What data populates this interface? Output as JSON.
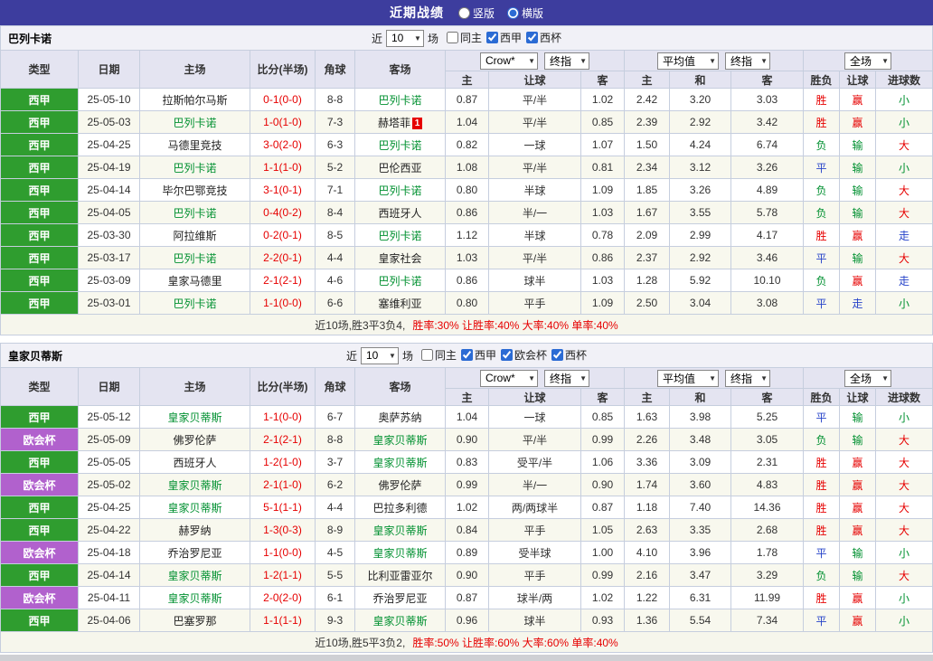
{
  "colors": {
    "topbar_bg": "#3d3d9e",
    "league_green": "#2f9d2f",
    "league_purple": "#b161cd",
    "win_red": "#e60000",
    "lose_green": "#009030",
    "draw_blue": "#2743c9",
    "header_bg": "#e4e4f1",
    "alt_row_bg": "#f8f8ee"
  },
  "topbar": {
    "title": "近期战绩",
    "radios": [
      {
        "label": "竖版",
        "selected": false
      },
      {
        "label": "横版",
        "selected": true
      }
    ]
  },
  "sections": [
    {
      "team": "巴列卡诺",
      "filter": {
        "near": "近",
        "count": "10",
        "unit": "场",
        "checks": [
          {
            "label": "同主",
            "checked": false
          },
          {
            "label": "西甲",
            "checked": true
          },
          {
            "label": "西杯",
            "checked": true
          }
        ]
      },
      "header": {
        "cols": [
          "类型",
          "日期",
          "主场",
          "比分(半场)",
          "角球",
          "客场"
        ],
        "odds1": [
          "Crow*",
          "终指"
        ],
        "odds2": [
          "平均值",
          "终指"
        ],
        "full": "全场",
        "sub": [
          "主",
          "让球",
          "客",
          "主",
          "和",
          "客",
          "胜负",
          "让球",
          "进球数"
        ]
      },
      "rows": [
        {
          "league": "西甲",
          "lc": "g",
          "date": "25-05-10",
          "home": "拉斯帕尔马斯",
          "hf": false,
          "score": "0-1(0-0)",
          "corner": "8-8",
          "away": "巴列卡诺",
          "af": true,
          "o": [
            "0.87",
            "平/半",
            "1.02"
          ],
          "a": [
            "2.42",
            "3.20",
            "3.03"
          ],
          "res": [
            [
              "胜",
              "r"
            ],
            [
              "赢",
              "r"
            ],
            [
              "小",
              "g"
            ]
          ]
        },
        {
          "league": "西甲",
          "lc": "g",
          "date": "25-05-03",
          "home": "巴列卡诺",
          "hf": true,
          "score": "1-0(1-0)",
          "corner": "7-3",
          "away": "赫塔菲",
          "af": false,
          "away_badge": "1",
          "o": [
            "1.04",
            "平/半",
            "0.85"
          ],
          "a": [
            "2.39",
            "2.92",
            "3.42"
          ],
          "res": [
            [
              "胜",
              "r"
            ],
            [
              "赢",
              "r"
            ],
            [
              "小",
              "g"
            ]
          ]
        },
        {
          "league": "西甲",
          "lc": "g",
          "date": "25-04-25",
          "home": "马德里竞技",
          "hf": false,
          "score": "3-0(2-0)",
          "corner": "6-3",
          "away": "巴列卡诺",
          "af": true,
          "o": [
            "0.82",
            "一球",
            "1.07"
          ],
          "a": [
            "1.50",
            "4.24",
            "6.74"
          ],
          "res": [
            [
              "负",
              "g"
            ],
            [
              "输",
              "g"
            ],
            [
              "大",
              "r"
            ]
          ]
        },
        {
          "league": "西甲",
          "lc": "g",
          "date": "25-04-19",
          "home": "巴列卡诺",
          "hf": true,
          "score": "1-1(1-0)",
          "corner": "5-2",
          "away": "巴伦西亚",
          "af": false,
          "o": [
            "1.08",
            "平/半",
            "0.81"
          ],
          "a": [
            "2.34",
            "3.12",
            "3.26"
          ],
          "res": [
            [
              "平",
              "b"
            ],
            [
              "输",
              "g"
            ],
            [
              "小",
              "g"
            ]
          ]
        },
        {
          "league": "西甲",
          "lc": "g",
          "date": "25-04-14",
          "home": "毕尔巴鄂竞技",
          "hf": false,
          "score": "3-1(0-1)",
          "corner": "7-1",
          "away": "巴列卡诺",
          "af": true,
          "o": [
            "0.80",
            "半球",
            "1.09"
          ],
          "a": [
            "1.85",
            "3.26",
            "4.89"
          ],
          "res": [
            [
              "负",
              "g"
            ],
            [
              "输",
              "g"
            ],
            [
              "大",
              "r"
            ]
          ]
        },
        {
          "league": "西甲",
          "lc": "g",
          "date": "25-04-05",
          "home": "巴列卡诺",
          "hf": true,
          "score": "0-4(0-2)",
          "corner": "8-4",
          "away": "西班牙人",
          "af": false,
          "o": [
            "0.86",
            "半/一",
            "1.03"
          ],
          "a": [
            "1.67",
            "3.55",
            "5.78"
          ],
          "res": [
            [
              "负",
              "g"
            ],
            [
              "输",
              "g"
            ],
            [
              "大",
              "r"
            ]
          ]
        },
        {
          "league": "西甲",
          "lc": "g",
          "date": "25-03-30",
          "home": "阿拉维斯",
          "hf": false,
          "score": "0-2(0-1)",
          "corner": "8-5",
          "away": "巴列卡诺",
          "af": true,
          "o": [
            "1.12",
            "半球",
            "0.78"
          ],
          "a": [
            "2.09",
            "2.99",
            "4.17"
          ],
          "res": [
            [
              "胜",
              "r"
            ],
            [
              "赢",
              "r"
            ],
            [
              "走",
              "b"
            ]
          ]
        },
        {
          "league": "西甲",
          "lc": "g",
          "date": "25-03-17",
          "home": "巴列卡诺",
          "hf": true,
          "score": "2-2(0-1)",
          "corner": "4-4",
          "away": "皇家社会",
          "af": false,
          "o": [
            "1.03",
            "平/半",
            "0.86"
          ],
          "a": [
            "2.37",
            "2.92",
            "3.46"
          ],
          "res": [
            [
              "平",
              "b"
            ],
            [
              "输",
              "g"
            ],
            [
              "大",
              "r"
            ]
          ]
        },
        {
          "league": "西甲",
          "lc": "g",
          "date": "25-03-09",
          "home": "皇家马德里",
          "hf": false,
          "score": "2-1(2-1)",
          "corner": "4-6",
          "away": "巴列卡诺",
          "af": true,
          "o": [
            "0.86",
            "球半",
            "1.03"
          ],
          "a": [
            "1.28",
            "5.92",
            "10.10"
          ],
          "res": [
            [
              "负",
              "g"
            ],
            [
              "赢",
              "r"
            ],
            [
              "走",
              "b"
            ]
          ]
        },
        {
          "league": "西甲",
          "lc": "g",
          "date": "25-03-01",
          "home": "巴列卡诺",
          "hf": true,
          "score": "1-1(0-0)",
          "corner": "6-6",
          "away": "塞维利亚",
          "af": false,
          "o": [
            "0.80",
            "平手",
            "1.09"
          ],
          "a": [
            "2.50",
            "3.04",
            "3.08"
          ],
          "res": [
            [
              "平",
              "b"
            ],
            [
              "走",
              "b"
            ],
            [
              "小",
              "g"
            ]
          ]
        }
      ],
      "footer": {
        "summary": "近10场,胜3平3负4,",
        "rates": "胜率:30% 让胜率:40% 大率:40% 单率:40%"
      }
    },
    {
      "team": "皇家贝蒂斯",
      "filter": {
        "near": "近",
        "count": "10",
        "unit": "场",
        "checks": [
          {
            "label": "同主",
            "checked": false
          },
          {
            "label": "西甲",
            "checked": true
          },
          {
            "label": "欧会杯",
            "checked": true
          },
          {
            "label": "西杯",
            "checked": true
          }
        ]
      },
      "header": {
        "cols": [
          "类型",
          "日期",
          "主场",
          "比分(半场)",
          "角球",
          "客场"
        ],
        "odds1": [
          "Crow*",
          "终指"
        ],
        "odds2": [
          "平均值",
          "终指"
        ],
        "full": "全场",
        "sub": [
          "主",
          "让球",
          "客",
          "主",
          "和",
          "客",
          "胜负",
          "让球",
          "进球数"
        ]
      },
      "rows": [
        {
          "league": "西甲",
          "lc": "g",
          "date": "25-05-12",
          "home": "皇家贝蒂斯",
          "hf": true,
          "score": "1-1(0-0)",
          "corner": "6-7",
          "away": "奥萨苏纳",
          "af": false,
          "o": [
            "1.04",
            "一球",
            "0.85"
          ],
          "a": [
            "1.63",
            "3.98",
            "5.25"
          ],
          "res": [
            [
              "平",
              "b"
            ],
            [
              "输",
              "g"
            ],
            [
              "小",
              "g"
            ]
          ]
        },
        {
          "league": "欧会杯",
          "lc": "p",
          "date": "25-05-09",
          "home": "佛罗伦萨",
          "hf": false,
          "score": "2-1(2-1)",
          "corner": "8-8",
          "away": "皇家贝蒂斯",
          "af": true,
          "o": [
            "0.90",
            "平/半",
            "0.99"
          ],
          "a": [
            "2.26",
            "3.48",
            "3.05"
          ],
          "res": [
            [
              "负",
              "g"
            ],
            [
              "输",
              "g"
            ],
            [
              "大",
              "r"
            ]
          ]
        },
        {
          "league": "西甲",
          "lc": "g",
          "date": "25-05-05",
          "home": "西班牙人",
          "hf": false,
          "score": "1-2(1-0)",
          "corner": "3-7",
          "away": "皇家贝蒂斯",
          "af": true,
          "o": [
            "0.83",
            "受平/半",
            "1.06"
          ],
          "a": [
            "3.36",
            "3.09",
            "2.31"
          ],
          "res": [
            [
              "胜",
              "r"
            ],
            [
              "赢",
              "r"
            ],
            [
              "大",
              "r"
            ]
          ]
        },
        {
          "league": "欧会杯",
          "lc": "p",
          "date": "25-05-02",
          "home": "皇家贝蒂斯",
          "hf": true,
          "score": "2-1(1-0)",
          "corner": "6-2",
          "away": "佛罗伦萨",
          "af": false,
          "o": [
            "0.99",
            "半/一",
            "0.90"
          ],
          "a": [
            "1.74",
            "3.60",
            "4.83"
          ],
          "res": [
            [
              "胜",
              "r"
            ],
            [
              "赢",
              "r"
            ],
            [
              "大",
              "r"
            ]
          ]
        },
        {
          "league": "西甲",
          "lc": "g",
          "date": "25-04-25",
          "home": "皇家贝蒂斯",
          "hf": true,
          "score": "5-1(1-1)",
          "corner": "4-4",
          "away": "巴拉多利德",
          "af": false,
          "o": [
            "1.02",
            "两/两球半",
            "0.87"
          ],
          "a": [
            "1.18",
            "7.40",
            "14.36"
          ],
          "res": [
            [
              "胜",
              "r"
            ],
            [
              "赢",
              "r"
            ],
            [
              "大",
              "r"
            ]
          ]
        },
        {
          "league": "西甲",
          "lc": "g",
          "date": "25-04-22",
          "home": "赫罗纳",
          "hf": false,
          "score": "1-3(0-3)",
          "corner": "8-9",
          "away": "皇家贝蒂斯",
          "af": true,
          "o": [
            "0.84",
            "平手",
            "1.05"
          ],
          "a": [
            "2.63",
            "3.35",
            "2.68"
          ],
          "res": [
            [
              "胜",
              "r"
            ],
            [
              "赢",
              "r"
            ],
            [
              "大",
              "r"
            ]
          ]
        },
        {
          "league": "欧会杯",
          "lc": "p",
          "date": "25-04-18",
          "home": "乔治罗尼亚",
          "hf": false,
          "score": "1-1(0-0)",
          "corner": "4-5",
          "away": "皇家贝蒂斯",
          "af": true,
          "o": [
            "0.89",
            "受半球",
            "1.00"
          ],
          "a": [
            "4.10",
            "3.96",
            "1.78"
          ],
          "res": [
            [
              "平",
              "b"
            ],
            [
              "输",
              "g"
            ],
            [
              "小",
              "g"
            ]
          ]
        },
        {
          "league": "西甲",
          "lc": "g",
          "date": "25-04-14",
          "home": "皇家贝蒂斯",
          "hf": true,
          "score": "1-2(1-1)",
          "corner": "5-5",
          "away": "比利亚雷亚尔",
          "af": false,
          "o": [
            "0.90",
            "平手",
            "0.99"
          ],
          "a": [
            "2.16",
            "3.47",
            "3.29"
          ],
          "res": [
            [
              "负",
              "g"
            ],
            [
              "输",
              "g"
            ],
            [
              "大",
              "r"
            ]
          ]
        },
        {
          "league": "欧会杯",
          "lc": "p",
          "date": "25-04-11",
          "home": "皇家贝蒂斯",
          "hf": true,
          "score": "2-0(2-0)",
          "corner": "6-1",
          "away": "乔治罗尼亚",
          "af": false,
          "o": [
            "0.87",
            "球半/两",
            "1.02"
          ],
          "a": [
            "1.22",
            "6.31",
            "11.99"
          ],
          "res": [
            [
              "胜",
              "r"
            ],
            [
              "赢",
              "r"
            ],
            [
              "小",
              "g"
            ]
          ]
        },
        {
          "league": "西甲",
          "lc": "g",
          "date": "25-04-06",
          "home": "巴塞罗那",
          "hf": false,
          "score": "1-1(1-1)",
          "corner": "9-3",
          "away": "皇家贝蒂斯",
          "af": true,
          "o": [
            "0.96",
            "球半",
            "0.93"
          ],
          "a": [
            "1.36",
            "5.54",
            "7.34"
          ],
          "res": [
            [
              "平",
              "b"
            ],
            [
              "赢",
              "r"
            ],
            [
              "小",
              "g"
            ]
          ]
        }
      ],
      "footer": {
        "summary": "近10场,胜5平3负2,",
        "rates": "胜率:50% 让胜率:60% 大率:60% 单率:40%"
      }
    }
  ]
}
